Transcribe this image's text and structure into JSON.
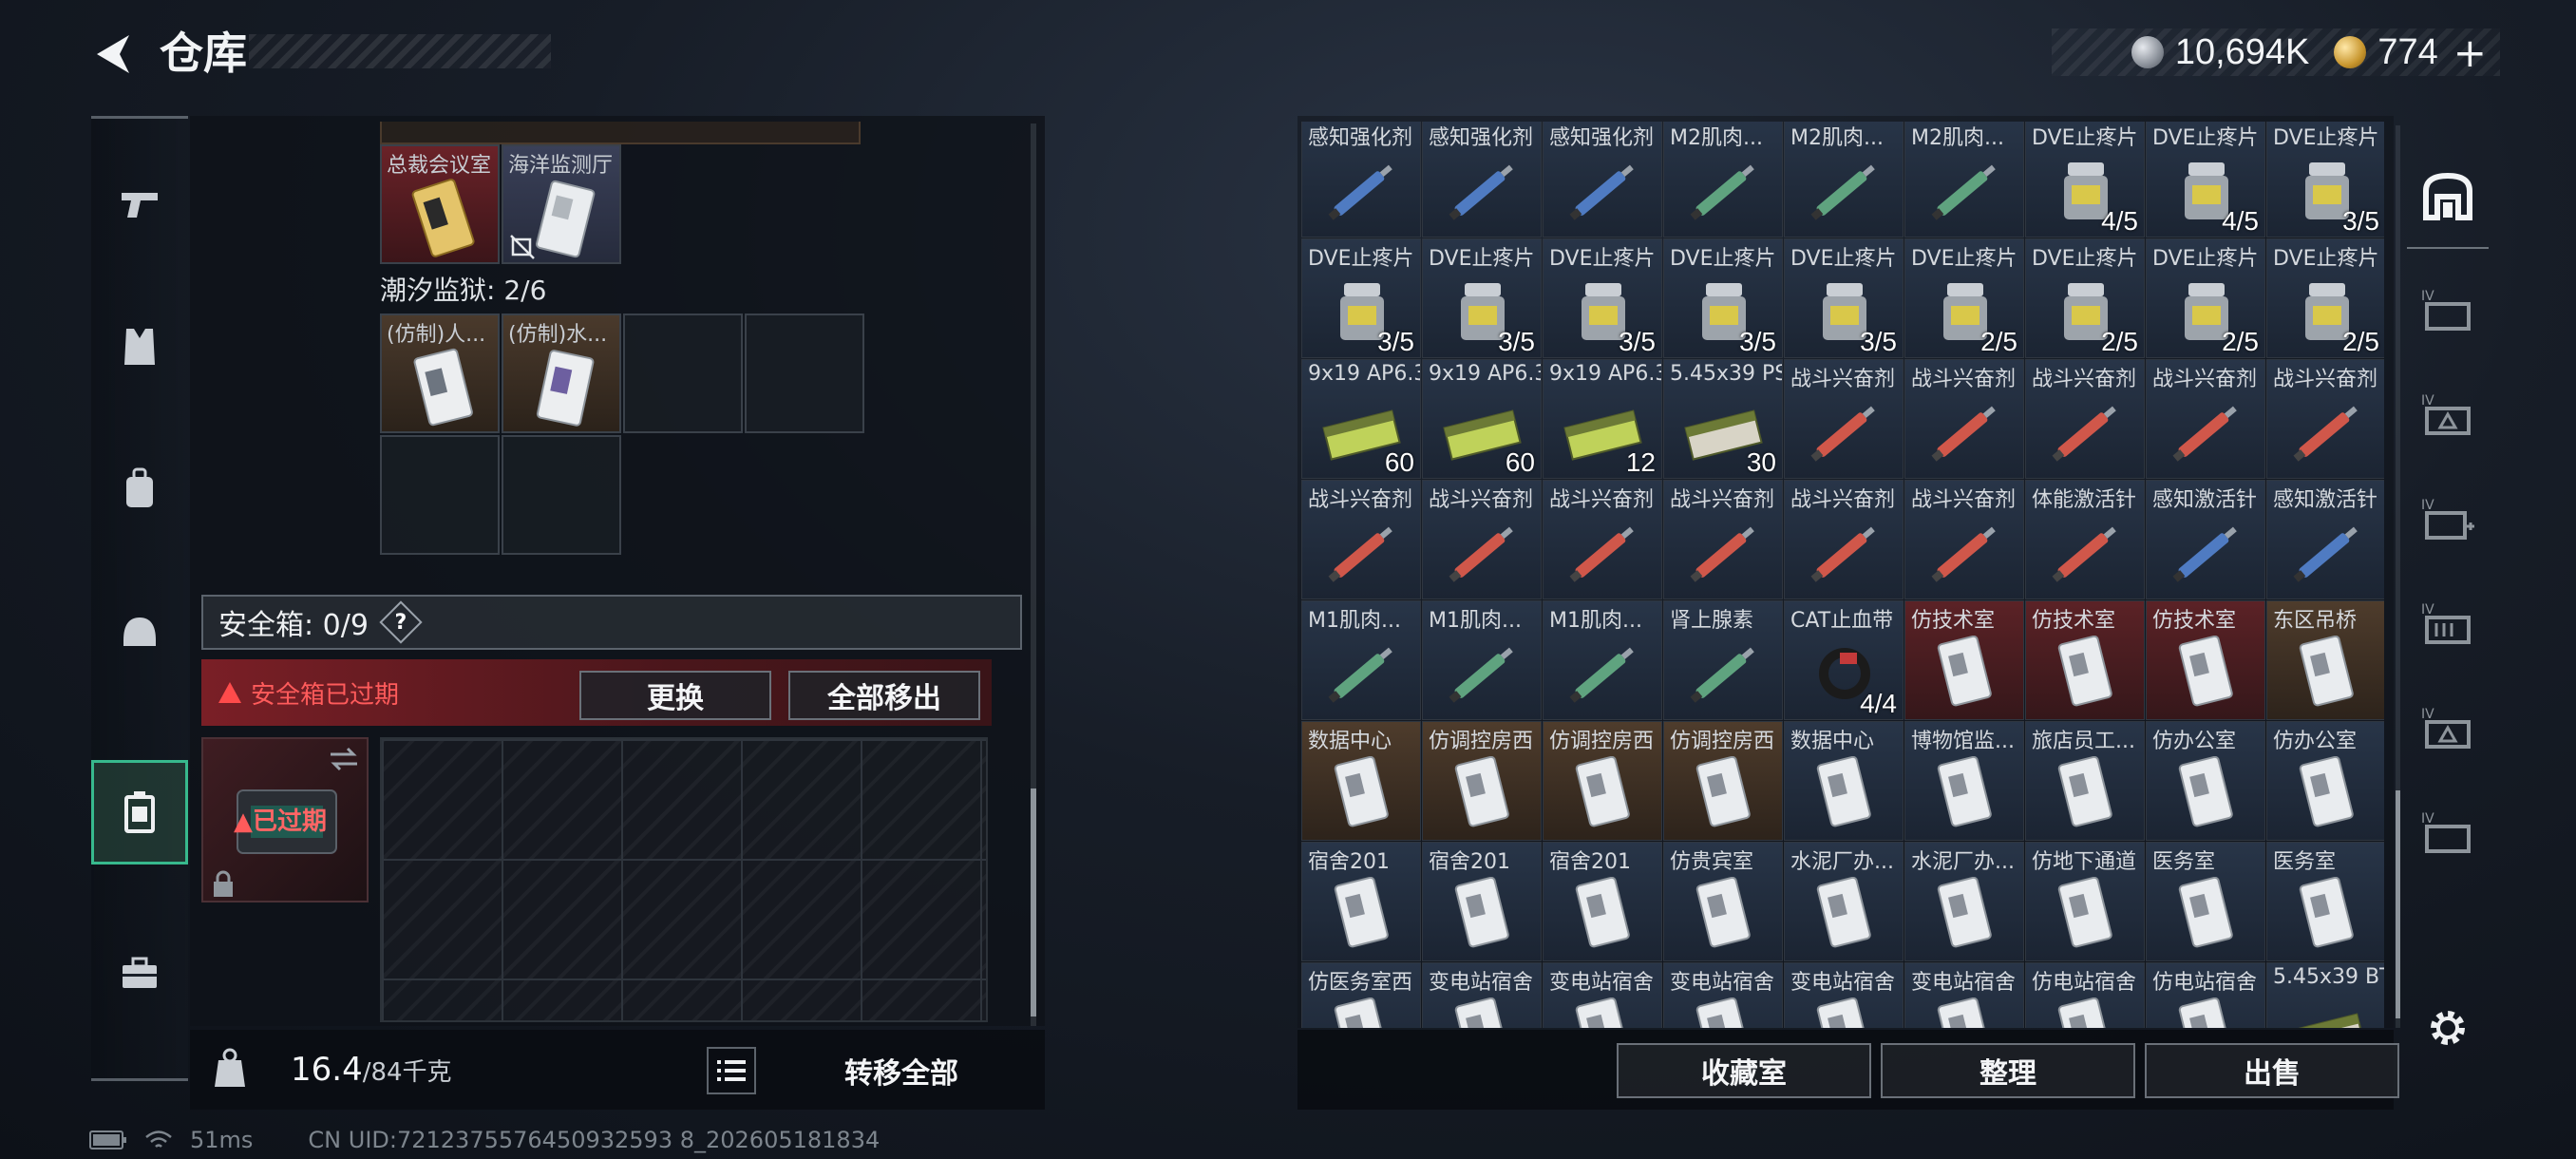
{
  "header": {
    "title": "仓库",
    "currency": [
      {
        "icon": "silver-coin-icon",
        "value": "10,694K"
      },
      {
        "icon": "gold-coin-icon",
        "value": "774"
      }
    ],
    "plus_label": "+"
  },
  "left_nav": {
    "items": [
      "gun-icon",
      "armor-vest-icon",
      "backpack-icon",
      "helmet-icon",
      "safe-box-icon",
      "toolbox-icon"
    ],
    "active_index": 4
  },
  "left_panel": {
    "top_cells": [
      {
        "label": "总裁会议室",
        "bg": "red"
      },
      {
        "label": "海洋监测厅",
        "bg": "blue"
      }
    ],
    "prison_label": "潮汐监狱: 2/6",
    "prison_cells": [
      {
        "label": "(仿制)人...",
        "bg": "brown"
      },
      {
        "label": "(仿制)水...",
        "bg": "brown"
      }
    ],
    "safe_label": "安全箱: 0/9",
    "help_label": "?",
    "expired_msg": "安全箱已过期",
    "replace_btn": "更换",
    "move_all_out_btn": "全部移出",
    "case_expired_label": "已过期",
    "weight_value": "16.4",
    "weight_max": "/84千克",
    "transfer_all_btn": "转移全部"
  },
  "right_grid": {
    "rows": [
      [
        {
          "label": "感知强化剂",
          "bg": "blue",
          "count": ""
        },
        {
          "label": "感知强化剂",
          "bg": "blue",
          "count": ""
        },
        {
          "label": "感知强化剂",
          "bg": "blue",
          "count": ""
        },
        {
          "label": "M2肌肉...",
          "bg": "blue",
          "count": ""
        },
        {
          "label": "M2肌肉...",
          "bg": "blue",
          "count": ""
        },
        {
          "label": "M2肌肉...",
          "bg": "blue",
          "count": ""
        },
        {
          "label": "DVE止疼片",
          "bg": "blue",
          "count": "4/5"
        },
        {
          "label": "DVE止疼片",
          "bg": "blue",
          "count": "4/5"
        },
        {
          "label": "DVE止疼片",
          "bg": "blue",
          "count": "3/5"
        }
      ],
      [
        {
          "label": "DVE止疼片",
          "bg": "blue",
          "count": "3/5"
        },
        {
          "label": "DVE止疼片",
          "bg": "blue",
          "count": "3/5"
        },
        {
          "label": "DVE止疼片",
          "bg": "blue",
          "count": "3/5"
        },
        {
          "label": "DVE止疼片",
          "bg": "blue",
          "count": "3/5"
        },
        {
          "label": "DVE止疼片",
          "bg": "blue",
          "count": "3/5"
        },
        {
          "label": "DVE止疼片",
          "bg": "blue",
          "count": "2/5"
        },
        {
          "label": "DVE止疼片",
          "bg": "blue",
          "count": "2/5"
        },
        {
          "label": "DVE止疼片",
          "bg": "blue",
          "count": "2/5"
        },
        {
          "label": "DVE止疼片",
          "bg": "blue",
          "count": "2/5"
        }
      ],
      [
        {
          "label": "9x19 AP6.3",
          "bg": "blue",
          "count": "60"
        },
        {
          "label": "9x19 AP6.3",
          "bg": "blue",
          "count": "60"
        },
        {
          "label": "9x19 AP6.3",
          "bg": "blue",
          "count": "12"
        },
        {
          "label": "5.45x39 PS",
          "bg": "blue",
          "count": "30"
        },
        {
          "label": "战斗兴奋剂",
          "bg": "blue",
          "count": ""
        },
        {
          "label": "战斗兴奋剂",
          "bg": "blue",
          "count": ""
        },
        {
          "label": "战斗兴奋剂",
          "bg": "blue",
          "count": ""
        },
        {
          "label": "战斗兴奋剂",
          "bg": "blue",
          "count": ""
        },
        {
          "label": "战斗兴奋剂",
          "bg": "blue",
          "count": ""
        }
      ],
      [
        {
          "label": "战斗兴奋剂",
          "bg": "blue",
          "count": ""
        },
        {
          "label": "战斗兴奋剂",
          "bg": "blue",
          "count": ""
        },
        {
          "label": "战斗兴奋剂",
          "bg": "blue",
          "count": ""
        },
        {
          "label": "战斗兴奋剂",
          "bg": "blue",
          "count": ""
        },
        {
          "label": "战斗兴奋剂",
          "bg": "blue",
          "count": ""
        },
        {
          "label": "战斗兴奋剂",
          "bg": "blue",
          "count": ""
        },
        {
          "label": "体能激活针",
          "bg": "blue",
          "count": ""
        },
        {
          "label": "感知激活针",
          "bg": "blue",
          "count": ""
        },
        {
          "label": "感知激活针",
          "bg": "blue",
          "count": ""
        }
      ],
      [
        {
          "label": "M1肌肉...",
          "bg": "blue",
          "count": ""
        },
        {
          "label": "M1肌肉...",
          "bg": "blue",
          "count": ""
        },
        {
          "label": "M1肌肉...",
          "bg": "blue",
          "count": ""
        },
        {
          "label": "肾上腺素",
          "bg": "blue",
          "count": ""
        },
        {
          "label": "CAT止血带",
          "bg": "blue",
          "count": "4/4"
        },
        {
          "label": "仿技术室",
          "bg": "red",
          "count": ""
        },
        {
          "label": "仿技术室",
          "bg": "red",
          "count": ""
        },
        {
          "label": "仿技术室",
          "bg": "red",
          "count": ""
        },
        {
          "label": "东区吊桥",
          "bg": "brown",
          "count": ""
        }
      ],
      [
        {
          "label": "数据中心",
          "bg": "brown",
          "count": ""
        },
        {
          "label": "仿调控房西",
          "bg": "brown",
          "count": ""
        },
        {
          "label": "仿调控房西",
          "bg": "brown",
          "count": ""
        },
        {
          "label": "仿调控房西",
          "bg": "brown",
          "count": ""
        },
        {
          "label": "数据中心",
          "bg": "blue",
          "count": ""
        },
        {
          "label": "博物馆监...",
          "bg": "blue",
          "count": ""
        },
        {
          "label": "旅店员工...",
          "bg": "blue",
          "count": ""
        },
        {
          "label": "仿办公室",
          "bg": "blue",
          "count": ""
        },
        {
          "label": "仿办公室",
          "bg": "blue",
          "count": ""
        }
      ],
      [
        {
          "label": "宿舍201",
          "bg": "blue",
          "count": ""
        },
        {
          "label": "宿舍201",
          "bg": "blue",
          "count": ""
        },
        {
          "label": "宿舍201",
          "bg": "blue",
          "count": ""
        },
        {
          "label": "仿贵宾室",
          "bg": "blue",
          "count": ""
        },
        {
          "label": "水泥厂办...",
          "bg": "blue",
          "count": ""
        },
        {
          "label": "水泥厂办...",
          "bg": "blue",
          "count": ""
        },
        {
          "label": "仿地下通道",
          "bg": "blue",
          "count": ""
        },
        {
          "label": "医务室",
          "bg": "blue",
          "count": ""
        },
        {
          "label": "医务室",
          "bg": "blue",
          "count": ""
        }
      ],
      [
        {
          "label": "仿医务室西",
          "bg": "blue",
          "count": ""
        },
        {
          "label": "变电站宿舍",
          "bg": "blue",
          "count": ""
        },
        {
          "label": "变电站宿舍",
          "bg": "blue",
          "count": ""
        },
        {
          "label": "变电站宿舍",
          "bg": "blue",
          "count": ""
        },
        {
          "label": "变电站宿舍",
          "bg": "blue",
          "count": ""
        },
        {
          "label": "变电站宿舍",
          "bg": "blue",
          "count": ""
        },
        {
          "label": "仿电站宿舍",
          "bg": "blue",
          "count": ""
        },
        {
          "label": "仿电站宿舍",
          "bg": "blue",
          "count": ""
        },
        {
          "label": "5.45x39 BT",
          "bg": "blue",
          "count": ""
        }
      ]
    ]
  },
  "right_footer": {
    "collection_btn": "收藏室",
    "sort_btn": "整理",
    "sell_btn": "出售"
  },
  "right_rail": {
    "items": [
      "stash-icon",
      "storage-iv-a-icon",
      "storage-iv-b-icon",
      "storage-iv-c-icon",
      "storage-iv-d-icon",
      "storage-iv-e-icon",
      "storage-iv-f-icon"
    ],
    "settings_icon": "gear-icon"
  },
  "status_bar": {
    "ping": "51ms",
    "uid": "CN UID:7212375576450932593 8_202605181834"
  },
  "colors": {
    "accent_green": "#37b98d",
    "warning_red": "#ff4b4b",
    "panel_bg": "#0e1218"
  }
}
